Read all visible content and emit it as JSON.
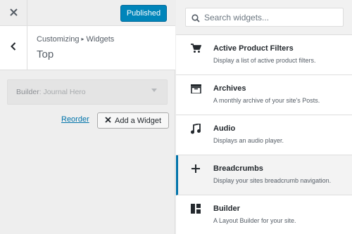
{
  "header": {
    "close_icon": "close-icon",
    "publish_label": "Published",
    "accent_color": "#0085ba"
  },
  "section": {
    "breadcrumb_parent": "Customizing",
    "breadcrumb_separator": "▸",
    "breadcrumb_child": "Widgets",
    "title": "Top",
    "back_icon": "chevron-left-icon"
  },
  "builder_select": {
    "label": "Builder",
    "value": "Journal Hero"
  },
  "actions": {
    "reorder_label": "Reorder",
    "add_widget_label": "Add a Widget"
  },
  "search": {
    "placeholder": "Search widgets..."
  },
  "widgets": [
    {
      "name": "Active Product Filters",
      "description": "Display a list of active product filters.",
      "icon": "cart-icon"
    },
    {
      "name": "Archives",
      "description": "A monthly archive of your site's Posts.",
      "icon": "archive-icon"
    },
    {
      "name": "Audio",
      "description": "Displays an audio player.",
      "icon": "music-note-icon"
    },
    {
      "name": "Breadcrumbs",
      "description": "Display your sites breadcrumb navigation.",
      "icon": "plus-icon",
      "active": true
    },
    {
      "name": "Builder",
      "description": "A Layout Builder for your site.",
      "icon": "layout-icon"
    }
  ]
}
